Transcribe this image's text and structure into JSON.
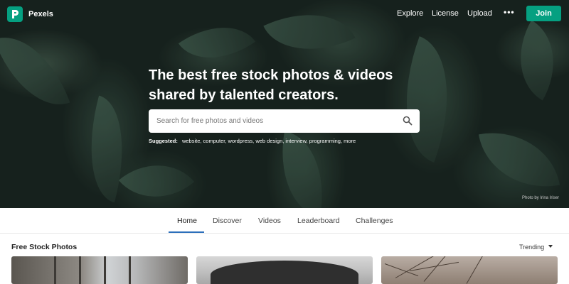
{
  "header": {
    "brand": "Pexels",
    "nav": [
      "Explore",
      "License",
      "Upload"
    ],
    "more": "•••",
    "join": "Join"
  },
  "hero": {
    "headline_line1": "The best free stock photos & videos",
    "headline_line2": "shared by talented creators.",
    "search_placeholder": "Search for free photos and videos",
    "suggested_label": "Suggested:",
    "suggested_terms": "website, computer, wordpress, web design, interview, programming, more",
    "credit": "Photo by Irina Iriser"
  },
  "tabs": [
    "Home",
    "Discover",
    "Videos",
    "Leaderboard",
    "Challenges"
  ],
  "active_tab": "Home",
  "section": {
    "title": "Free Stock Photos",
    "sort": "Trending"
  },
  "colors": {
    "accent": "#05a081",
    "tab_underline": "#2c6fbb"
  }
}
